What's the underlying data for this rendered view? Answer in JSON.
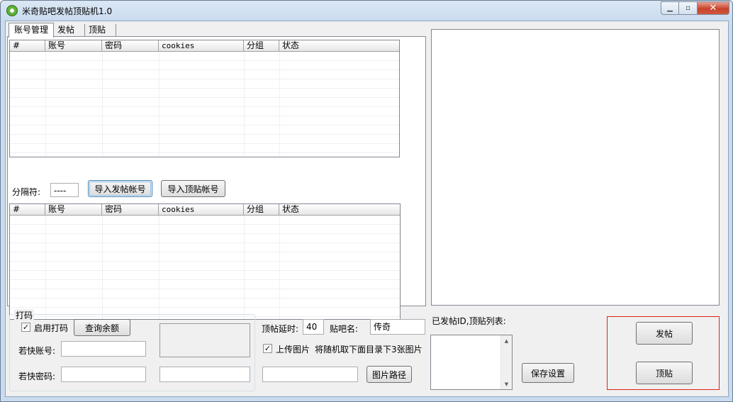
{
  "window": {
    "title": "米奇贴吧发帖顶贴机1.0",
    "controls": {
      "minimize": "▁",
      "maximize": "▫",
      "close": "✕"
    }
  },
  "tabs": [
    {
      "label": "账号管理",
      "active": true
    },
    {
      "label": "发帖",
      "active": false
    },
    {
      "label": "顶贴",
      "active": false
    }
  ],
  "account_grid_top": {
    "columns": [
      "#",
      "账号",
      "密码",
      "cookies",
      "分组",
      "状态"
    ],
    "rows": []
  },
  "separator_row": {
    "label": "分隔符:",
    "value": "----",
    "import_post_button": "导入发帖帐号",
    "import_bump_button": "导入顶贴帐号"
  },
  "account_grid_bottom": {
    "columns": [
      "#",
      "账号",
      "密码",
      "cookies",
      "分组",
      "状态"
    ],
    "rows": []
  },
  "captcha_group": {
    "legend": "打码",
    "enable_label": "启用打码",
    "enable_checked": true,
    "check_mark": "✓",
    "query_balance_button": "查询余额",
    "ruokuai_account_label": "若快账号:",
    "ruokuai_account_value": "",
    "ruokuai_password_label": "若快密码:",
    "ruokuai_password_value": ""
  },
  "bump_settings": {
    "delay_label": "顶帖延时:",
    "delay_value": "40",
    "forum_label": "贴吧名:",
    "forum_value": "传奇",
    "upload_label": "上传图片",
    "upload_checked": true,
    "upload_hint": "将随机取下面目录下3张图片",
    "image_path_value": "",
    "image_path_button": "图片路径"
  },
  "posted_list": {
    "label": "已发帖ID,顶贴列表:"
  },
  "actions": {
    "save_button": "保存设置",
    "post_button": "发帖",
    "bump_button": "顶贴"
  },
  "colors": {
    "accent_red": "#d9251c",
    "window_frame": "#c9dbef",
    "client_bg": "#f0f0f0"
  }
}
